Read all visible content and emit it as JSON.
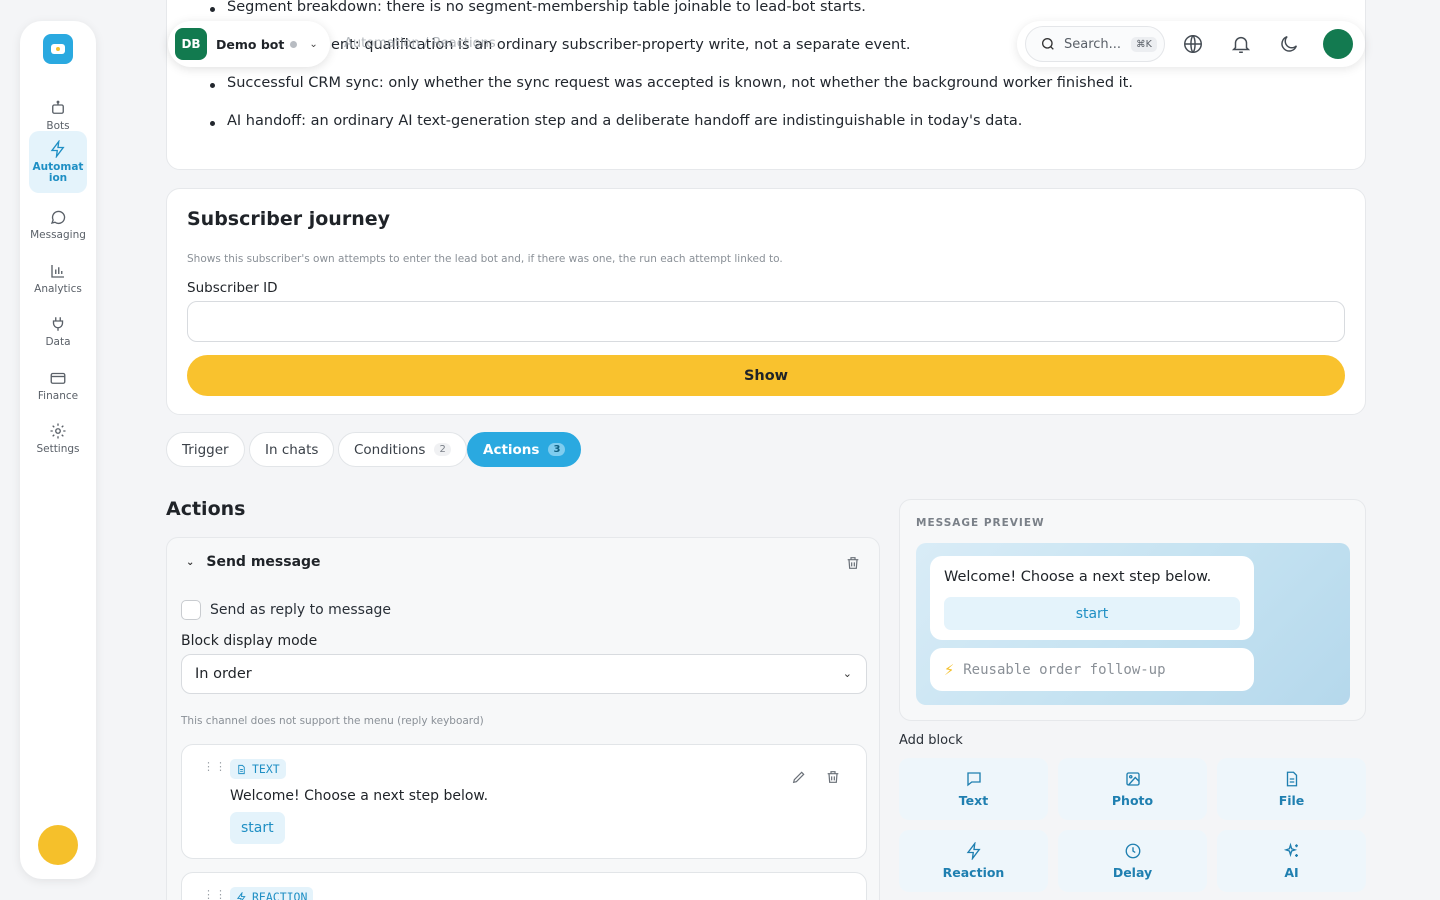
{
  "sidebar": {
    "items": [
      {
        "label": "Bots",
        "icon": "bot-icon"
      },
      {
        "label": "Automation",
        "icon": "lightning-icon"
      },
      {
        "label": "Messaging",
        "icon": "chat-icon"
      },
      {
        "label": "Analytics",
        "icon": "bar-chart-icon"
      },
      {
        "label": "Data",
        "icon": "plug-icon"
      },
      {
        "label": "Finance",
        "icon": "card-icon"
      },
      {
        "label": "Settings",
        "icon": "gear-icon"
      }
    ],
    "active": "Automation"
  },
  "top_card": {
    "bullets": [
      "Segment breakdown: there is no segment-membership table joinable to lead-bot starts.",
      "ent: qualification is an ordinary subscriber-property write, not a separate event.",
      "Successful CRM sync: only whether the sync request was accepted is known, not whether the background worker finished it.",
      "AI handoff: an ordinary AI text-generation step and a deliberate handoff are indistinguishable in today's data."
    ]
  },
  "header": {
    "bot_initials": "DB",
    "bot_name": "Demo bot",
    "breadcrumb": "Automation / Reactions",
    "search_placeholder": "Search...",
    "search_shortcut": "⌘K"
  },
  "journey": {
    "title": "Subscriber journey",
    "description": "Shows this subscriber's own attempts to enter the lead bot and, if there was one, the run each attempt linked to.",
    "field_label": "Subscriber ID",
    "field_value": "",
    "button_label": "Show"
  },
  "tabs": [
    {
      "label": "Trigger",
      "count": ""
    },
    {
      "label": "In chats",
      "count": ""
    },
    {
      "label": "Conditions",
      "count": "2"
    },
    {
      "label": "Actions",
      "count": "3"
    }
  ],
  "actions": {
    "title": "Actions",
    "send_message": "Send message",
    "reply_label": "Send as reply to message",
    "mode_label": "Block display mode",
    "mode_value": "In order",
    "note": "This channel does not support the menu (reply keyboard)",
    "blocks": [
      {
        "tag": "TEXT",
        "text": "Welcome! Choose a next step below.",
        "button": "start"
      },
      {
        "tag": "REACTION",
        "text": "",
        "button": ""
      }
    ]
  },
  "preview": {
    "title": "MESSAGE PREVIEW",
    "message": "Welcome! Choose a next step below.",
    "button": "start",
    "reaction": "Reusable order follow-up"
  },
  "add_block": {
    "label": "Add block",
    "buttons": [
      "Text",
      "Photo",
      "File",
      "Reaction",
      "Delay",
      "AI"
    ]
  },
  "colors": {
    "accent": "#2aa9e0",
    "primary_button": "#f9c22e",
    "bot_badge": "#127a4f"
  }
}
